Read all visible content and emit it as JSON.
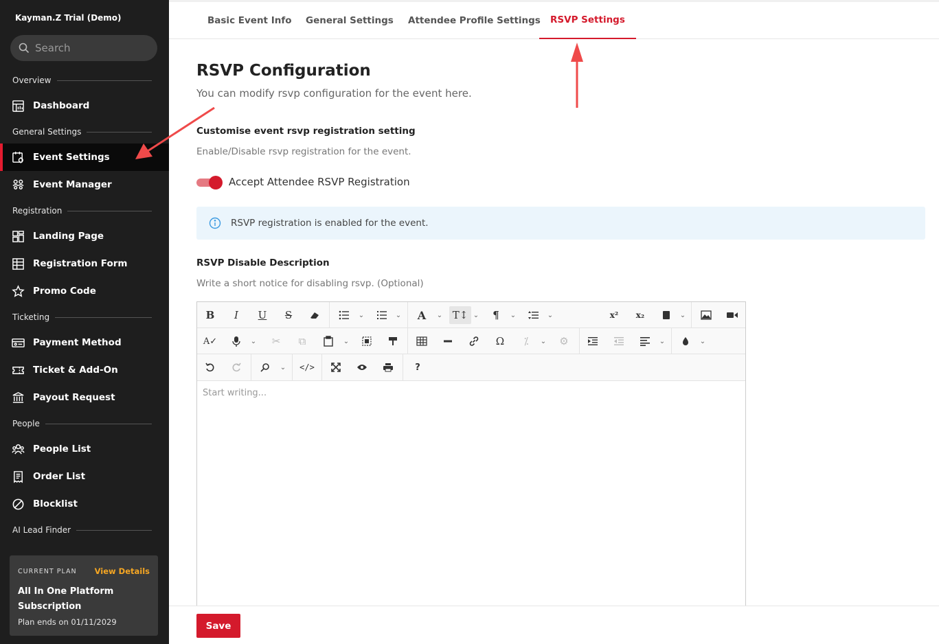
{
  "sidebar": {
    "org_name": "Kayman.Z Trial (Demo)",
    "search_placeholder": "Search",
    "sections": {
      "overview": "Overview",
      "general": "General Settings",
      "registration": "Registration",
      "ticketing": "Ticketing",
      "people": "People",
      "ai": "AI Lead Finder"
    },
    "items": {
      "dashboard": "Dashboard",
      "event_settings": "Event Settings",
      "event_manager": "Event Manager",
      "landing_page": "Landing Page",
      "registration_form": "Registration Form",
      "promo_code": "Promo Code",
      "payment_method": "Payment Method",
      "ticket_addon": "Ticket & Add-On",
      "payout_request": "Payout Request",
      "people_list": "People List",
      "order_list": "Order List",
      "blocklist": "Blocklist"
    },
    "plan": {
      "label": "CURRENT PLAN",
      "view_details": "View Details",
      "name": "All In One Platform Subscription",
      "ends": "Plan ends on 01/11/2029"
    }
  },
  "tabs": {
    "basic": "Basic Event Info",
    "general": "General Settings",
    "attendee": "Attendee Profile Settings",
    "rsvp": "RSVP Settings"
  },
  "main": {
    "title": "RSVP Configuration",
    "subtitle": "You can modify rsvp configuration for the event here.",
    "customise_heading": "Customise event rsvp registration setting",
    "customise_desc": "Enable/Disable rsvp registration for the event.",
    "toggle_label": "Accept Attendee RSVP Registration",
    "toggle_on": true,
    "info_text": "RSVP registration is enabled for the event.",
    "disable_heading": "RSVP Disable Description",
    "disable_desc": "Write a short notice for disabling rsvp. (Optional)",
    "editor_placeholder": "Start writing..."
  },
  "footer": {
    "save_label": "Save"
  },
  "colors": {
    "accent": "#d41a2c",
    "sidebar_bg": "#1e1e1e",
    "plan_link": "#f5a623",
    "info_bg": "#ebf5fc",
    "annotation_arrow": "#ef4a4a"
  }
}
